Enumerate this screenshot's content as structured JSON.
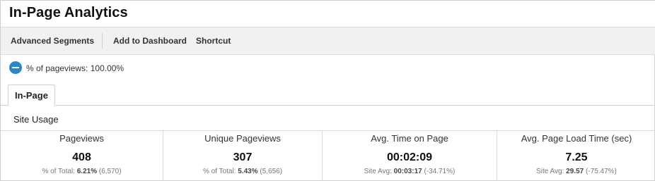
{
  "page": {
    "title": "In-Page Analytics"
  },
  "toolbar": {
    "advanced_segments": "Advanced Segments",
    "add_to_dashboard": "Add to Dashboard",
    "shortcut": "Shortcut"
  },
  "segment": {
    "icon": "pie-chart-icon",
    "label": "% of pageviews: 100.00%",
    "color": "#2b87c6"
  },
  "tabs": [
    {
      "label": "In-Page"
    }
  ],
  "section": {
    "title": "Site Usage"
  },
  "metrics": [
    {
      "label": "Pageviews",
      "value": "408",
      "sub_prefix": "% of Total:",
      "sub_value": "6.21%",
      "sub_suffix": "(6,570)"
    },
    {
      "label": "Unique Pageviews",
      "value": "307",
      "sub_prefix": "% of Total:",
      "sub_value": "5.43%",
      "sub_suffix": "(5,656)"
    },
    {
      "label": "Avg. Time on Page",
      "value": "00:02:09",
      "sub_prefix": "Site Avg:",
      "sub_value": "00:03:17",
      "sub_suffix": "(-34.71%)"
    },
    {
      "label": "Avg. Page Load Time (sec)",
      "value": "7.25",
      "sub_prefix": "Site Avg:",
      "sub_value": "29.57",
      "sub_suffix": "(-75.47%)"
    }
  ]
}
